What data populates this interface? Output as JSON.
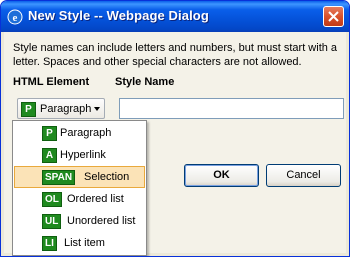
{
  "window": {
    "title": "New Style -- Webpage Dialog"
  },
  "description": "Style names can include letters and numbers, but must start with a letter. Spaces and other special characters are not allowed.",
  "labels": {
    "html_element": "HTML Element",
    "style_name": "Style Name"
  },
  "element_dropdown": {
    "badge": "P",
    "value": "Paragraph"
  },
  "style_name_input": {
    "value": "",
    "placeholder": ""
  },
  "buttons": {
    "ok": "OK",
    "cancel": "Cancel"
  },
  "menu": {
    "items": [
      {
        "badge": "P",
        "label": "Paragraph"
      },
      {
        "badge": "A",
        "label": "Hyperlink"
      },
      {
        "badge": "SPAN",
        "label": "Selection",
        "selected": true
      },
      {
        "badge": "OL",
        "label": "Ordered list"
      },
      {
        "badge": "UL",
        "label": "Unordered list"
      },
      {
        "badge": "LI",
        "label": "List item"
      }
    ]
  },
  "colors": {
    "badge": "#1f8a1f",
    "titlebar": "#0a5fea",
    "selection": "#fbe3b7"
  }
}
